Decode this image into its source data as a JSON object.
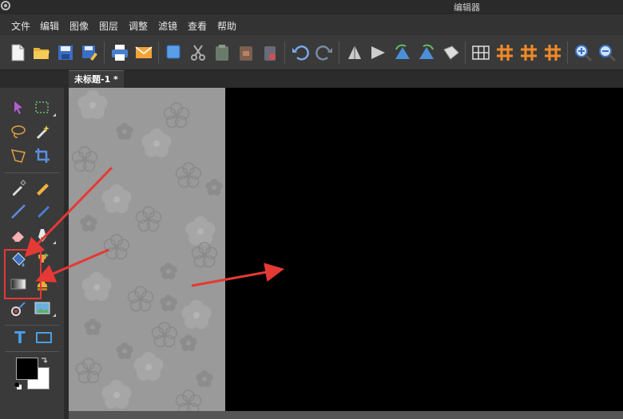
{
  "window": {
    "title": "编辑器"
  },
  "menu": {
    "items": [
      {
        "id": "file",
        "label": "文件"
      },
      {
        "id": "edit",
        "label": "编辑"
      },
      {
        "id": "image",
        "label": "图像"
      },
      {
        "id": "layer",
        "label": "图层"
      },
      {
        "id": "adjust",
        "label": "调整"
      },
      {
        "id": "filter",
        "label": "滤镜"
      },
      {
        "id": "view",
        "label": "查看"
      },
      {
        "id": "help",
        "label": "帮助"
      }
    ]
  },
  "document": {
    "tab_label": "未标题-1 *"
  },
  "tools": {
    "text_tool_glyph": "T"
  },
  "colors": {
    "primary": "#000000",
    "secondary": "#ffffff",
    "canvas_bg": "#000000",
    "pattern_bg": "#9a9a9a",
    "annotation": "#e53935"
  }
}
